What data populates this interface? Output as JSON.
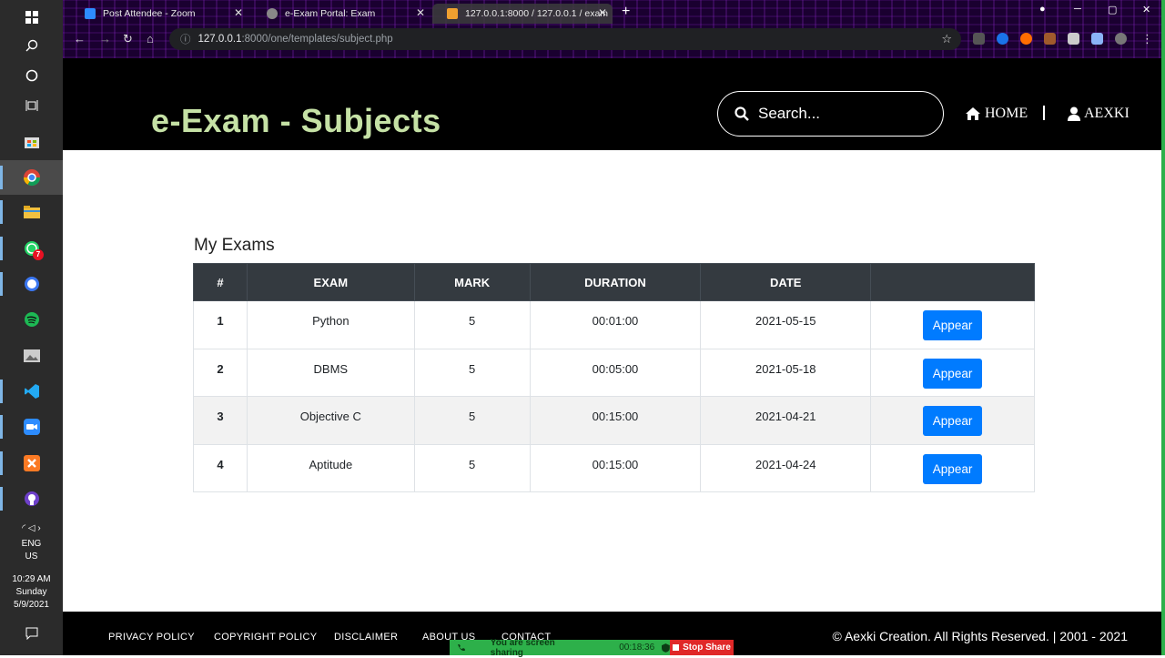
{
  "taskbar": {
    "tray": {
      "language": "ENG",
      "region": "US",
      "time": "10:29 AM",
      "day": "Sunday",
      "date": "5/9/2021"
    },
    "whatsapp_badge": "7"
  },
  "browser": {
    "tabs": [
      {
        "title": "Post Attendee - Zoom",
        "color": "#2d8cff"
      },
      {
        "title": "e-Exam Portal: Exam",
        "color": "#888888"
      },
      {
        "title": "127.0.0.1:8000 / 127.0.0.1 / exam",
        "color": "#f0a030"
      }
    ],
    "url_host": "127.0.0.1",
    "url_path": ":8000/one/templates/subject.php"
  },
  "header": {
    "title": "e-Exam - Subjects",
    "search_placeholder": "Search...",
    "nav": {
      "home": "HOME",
      "user": "AEXKI"
    }
  },
  "main": {
    "section_title": "My Exams",
    "columns": [
      "#",
      "EXAM",
      "MARK",
      "DURATION",
      "DATE",
      ""
    ],
    "rows": [
      {
        "num": "1",
        "exam": "Python",
        "mark": "5",
        "duration": "00:01:00",
        "date": "2021-05-15",
        "action": "Appear"
      },
      {
        "num": "2",
        "exam": "DBMS",
        "mark": "5",
        "duration": "00:05:00",
        "date": "2021-05-18",
        "action": "Appear"
      },
      {
        "num": "3",
        "exam": "Objective C",
        "mark": "5",
        "duration": "00:15:00",
        "date": "2021-04-21",
        "action": "Appear"
      },
      {
        "num": "4",
        "exam": "Aptitude",
        "mark": "5",
        "duration": "00:15:00",
        "date": "2021-04-24",
        "action": "Appear"
      }
    ]
  },
  "footer": {
    "links": [
      "PRIVACY POLICY",
      "COPYRIGHT POLICY",
      "DISCLAIMER",
      "ABOUT US",
      "CONTACT"
    ],
    "copyright": "© Aexki Creation. All Rights Reserved. | 2001 - 2021"
  },
  "zoom": {
    "message": "You are screen sharing",
    "timer": "00:18:36",
    "stop_label": "Stop Share"
  },
  "colors": {
    "accent_title": "#c5e1a5",
    "button": "#007bff",
    "table_header": "#343a40"
  }
}
